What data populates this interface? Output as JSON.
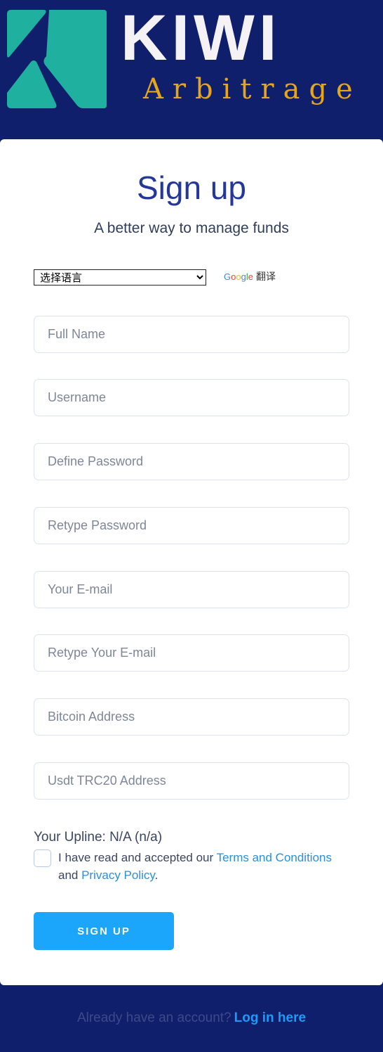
{
  "brand": {
    "name_line1": "KIWI",
    "name_line2": "Arbitrage",
    "colors": {
      "mark": "#1fb0a0",
      "kiwi_text": "#f4f2f5",
      "arbitrage_text": "#e6a619",
      "background": "#101f6b"
    }
  },
  "signup": {
    "title": "Sign up",
    "subtitle": "A better way to manage funds"
  },
  "language": {
    "selected": "选择语言",
    "options": [
      "选择语言"
    ],
    "google_letters": [
      "G",
      "o",
      "o",
      "g",
      "l",
      "e"
    ],
    "translate_label": "翻译"
  },
  "fields": {
    "full_name": {
      "placeholder": "Full Name",
      "value": ""
    },
    "username": {
      "placeholder": "Username",
      "value": ""
    },
    "password": {
      "placeholder": "Define Password",
      "value": ""
    },
    "retype_password": {
      "placeholder": "Retype Password",
      "value": ""
    },
    "email": {
      "placeholder": "Your E-mail",
      "value": ""
    },
    "retype_email": {
      "placeholder": "Retype Your E-mail",
      "value": ""
    },
    "bitcoin": {
      "placeholder": "Bitcoin Address",
      "value": ""
    },
    "usdt": {
      "placeholder": "Usdt TRC20 Address",
      "value": ""
    }
  },
  "upline": "Your Upline: N/A (n/a)",
  "terms": {
    "prefix": "I have read and accepted our ",
    "terms_link": "Terms and Conditions",
    "middle": " and ",
    "privacy_link": "Privacy Policy",
    "suffix": ".",
    "checked": false
  },
  "submit_label": "SIGN UP",
  "footer": {
    "prompt": "Already have an account?",
    "login_link": "Log in here"
  },
  "colors": {
    "accent": "#1ca6fb",
    "title": "#24389a",
    "link": "#2b8fdb"
  }
}
